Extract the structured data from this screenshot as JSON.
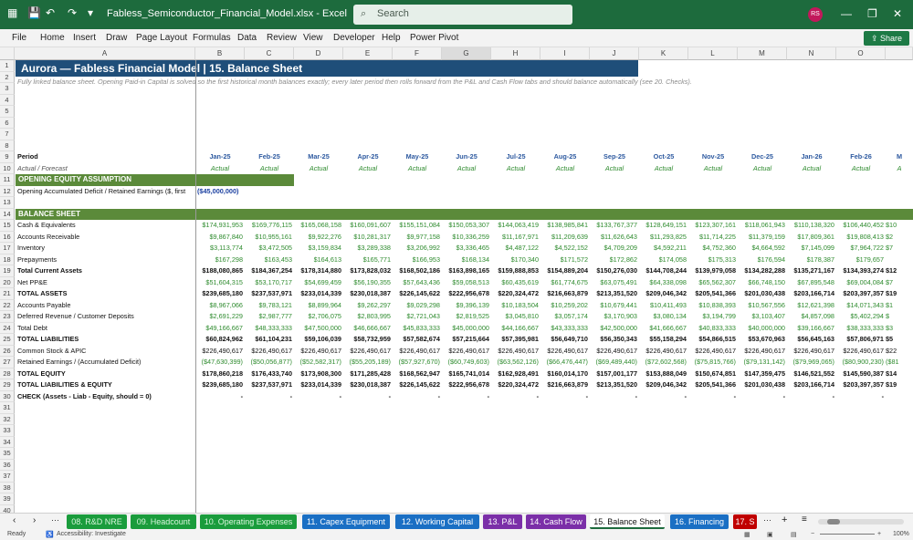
{
  "window": {
    "filename": "Fabless_Semiconductor_Financial_Model.xlsx",
    "app": "Excel",
    "search_placeholder": "Search",
    "avatar_initials": "RS"
  },
  "menu": [
    "File",
    "Home",
    "Insert",
    "Draw",
    "Page Layout",
    "Formulas",
    "Data",
    "Review",
    "View",
    "Developer",
    "Help",
    "Power Pivot"
  ],
  "share_label": "Share",
  "columns": [
    "A",
    "B",
    "C",
    "D",
    "E",
    "F",
    "G",
    "H",
    "I",
    "J",
    "K",
    "L",
    "M",
    "N",
    "O"
  ],
  "row_numbers": [
    "1",
    "2",
    "3",
    "4",
    "5",
    "6",
    "7",
    "8",
    "9",
    "10",
    "11",
    "12",
    "13",
    "14",
    "15",
    "16",
    "17",
    "18",
    "19",
    "20",
    "21",
    "22",
    "23",
    "24",
    "25",
    "26",
    "27",
    "28",
    "29",
    "30",
    "31",
    "32",
    "33",
    "34",
    "35",
    "36",
    "37",
    "38",
    "39",
    "40"
  ],
  "sheet": {
    "title": "Aurora — Fabless Financial Model  |  15. Balance Sheet",
    "note": "Fully linked balance sheet. Opening Paid-in Capital is solved so the first historical month balances exactly; every later period then rolls forward from the P&L and Cash Flow tabs and should balance automatically (see 20. Checks).",
    "period_label": "Period",
    "subtype_label": "Actual / Forecast",
    "periods": [
      "Jan-25",
      "Feb-25",
      "Mar-25",
      "Apr-25",
      "May-25",
      "Jun-25",
      "Jul-25",
      "Aug-25",
      "Sep-25",
      "Oct-25",
      "Nov-25",
      "Dec-25",
      "Jan-26",
      "Feb-26",
      "M"
    ],
    "subtypes": [
      "Actual",
      "Actual",
      "Actual",
      "Actual",
      "Actual",
      "Actual",
      "Actual",
      "Actual",
      "Actual",
      "Actual",
      "Actual",
      "Actual",
      "Actual",
      "Actual",
      "A"
    ],
    "opening_section": "OPENING EQUITY ASSUMPTION",
    "opening_label": "Opening Accumulated Deficit / Retained Earnings ($, first",
    "opening_value": "($45,000,000)",
    "balance_section": "BALANCE SHEET",
    "rows": [
      {
        "label": "Cash & Equivalents",
        "style": "n",
        "vals": [
          "$174,931,953",
          "$169,776,115",
          "$165,068,158",
          "$160,091,607",
          "$155,151,084",
          "$150,053,307",
          "$144,063,419",
          "$138,985,841",
          "$133,767,377",
          "$128,649,151",
          "$123,307,161",
          "$118,061,943",
          "$110,138,320",
          "$106,440,452",
          "$10"
        ]
      },
      {
        "label": "Accounts Receivable",
        "style": "n",
        "vals": [
          "$9,867,840",
          "$10,955,161",
          "$9,922,276",
          "$10,281,317",
          "$9,977,158",
          "$10,336,259",
          "$11,167,971",
          "$11,209,639",
          "$11,626,643",
          "$11,293,825",
          "$11,714,225",
          "$11,379,159",
          "$17,809,361",
          "$19,808,413",
          "$2"
        ]
      },
      {
        "label": "Inventory",
        "style": "n",
        "vals": [
          "$3,113,774",
          "$3,472,505",
          "$3,159,834",
          "$3,289,338",
          "$3,206,992",
          "$3,336,465",
          "$4,487,122",
          "$4,522,152",
          "$4,709,209",
          "$4,592,211",
          "$4,752,360",
          "$4,664,592",
          "$7,145,099",
          "$7,964,722",
          "$7"
        ]
      },
      {
        "label": "Prepayments",
        "style": "n",
        "vals": [
          "$167,298",
          "$163,453",
          "$164,613",
          "$165,771",
          "$166,953",
          "$168,134",
          "$170,340",
          "$171,572",
          "$172,862",
          "$174,058",
          "$175,313",
          "$176,594",
          "$178,387",
          "$179,657",
          ""
        ]
      },
      {
        "label": "Total Current Assets",
        "style": "b",
        "vals": [
          "$188,080,865",
          "$184,367,254",
          "$178,314,880",
          "$173,828,032",
          "$168,502,186",
          "$163,898,165",
          "$159,888,853",
          "$154,889,204",
          "$150,276,030",
          "$144,708,244",
          "$139,979,058",
          "$134,282,288",
          "$135,271,167",
          "$134,393,274",
          "$12"
        ]
      },
      {
        "label": "Net PP&E",
        "style": "n",
        "vals": [
          "$51,604,315",
          "$53,170,717",
          "$54,699,459",
          "$56,190,355",
          "$57,643,436",
          "$59,058,513",
          "$60,435,619",
          "$61,774,675",
          "$63,075,491",
          "$64,338,098",
          "$65,562,307",
          "$66,748,150",
          "$67,895,548",
          "$69,004,084",
          "$7"
        ]
      },
      {
        "label": "TOTAL ASSETS",
        "style": "b",
        "vals": [
          "$239,685,180",
          "$237,537,971",
          "$233,014,339",
          "$230,018,387",
          "$226,145,622",
          "$222,956,678",
          "$220,324,472",
          "$216,663,879",
          "$213,351,520",
          "$209,046,342",
          "$205,541,366",
          "$201,030,438",
          "$203,166,714",
          "$203,397,357",
          "$19"
        ]
      },
      {
        "label": "Accounts Payable",
        "style": "n",
        "vals": [
          "$8,967,066",
          "$9,783,121",
          "$8,899,964",
          "$9,262,297",
          "$9,029,298",
          "$9,396,139",
          "$10,183,504",
          "$10,259,202",
          "$10,679,441",
          "$10,411,493",
          "$10,838,393",
          "$10,567,556",
          "$12,621,398",
          "$14,071,343",
          "$1"
        ]
      },
      {
        "label": "Deferred Revenue / Customer Deposits",
        "style": "n",
        "vals": [
          "$2,691,229",
          "$2,987,777",
          "$2,706,075",
          "$2,803,995",
          "$2,721,043",
          "$2,819,525",
          "$3,045,810",
          "$3,057,174",
          "$3,170,903",
          "$3,080,134",
          "$3,194,799",
          "$3,103,407",
          "$4,857,098",
          "$5,402,294",
          "$"
        ]
      },
      {
        "label": "Total Debt",
        "style": "n",
        "vals": [
          "$49,166,667",
          "$48,333,333",
          "$47,500,000",
          "$46,666,667",
          "$45,833,333",
          "$45,000,000",
          "$44,166,667",
          "$43,333,333",
          "$42,500,000",
          "$41,666,667",
          "$40,833,333",
          "$40,000,000",
          "$39,166,667",
          "$38,333,333",
          "$3"
        ]
      },
      {
        "label": "TOTAL LIABILITIES",
        "style": "b",
        "vals": [
          "$60,824,962",
          "$61,104,231",
          "$59,106,039",
          "$58,732,959",
          "$57,582,674",
          "$57,215,664",
          "$57,395,981",
          "$56,649,710",
          "$56,350,343",
          "$55,158,294",
          "$54,866,515",
          "$53,670,963",
          "$56,645,163",
          "$57,806,971",
          "$5"
        ]
      },
      {
        "label": "Common Stock & APIC",
        "style": "k",
        "vals": [
          "$226,490,617",
          "$226,490,617",
          "$226,490,617",
          "$226,490,617",
          "$226,490,617",
          "$226,490,617",
          "$226,490,617",
          "$226,490,617",
          "$226,490,617",
          "$226,490,617",
          "$226,490,617",
          "$226,490,617",
          "$226,490,617",
          "$226,490,617",
          "$22"
        ]
      },
      {
        "label": "Retained Earnings / (Accumulated Deficit)",
        "style": "n",
        "vals": [
          "($47,630,399)",
          "($50,056,877)",
          "($52,582,317)",
          "($55,205,189)",
          "($57,927,670)",
          "($60,749,603)",
          "($63,562,126)",
          "($66,476,447)",
          "($69,489,440)",
          "($72,602,568)",
          "($75,815,766)",
          "($79,131,142)",
          "($79,969,065)",
          "($80,900,230)",
          "($81"
        ]
      },
      {
        "label": "TOTAL EQUITY",
        "style": "b",
        "vals": [
          "$178,860,218",
          "$176,433,740",
          "$173,908,300",
          "$171,285,428",
          "$168,562,947",
          "$165,741,014",
          "$162,928,491",
          "$160,014,170",
          "$157,001,177",
          "$153,888,049",
          "$150,674,851",
          "$147,359,475",
          "$146,521,552",
          "$145,590,387",
          "$14"
        ]
      },
      {
        "label": "TOTAL LIABILITIES & EQUITY",
        "style": "b",
        "vals": [
          "$239,685,180",
          "$237,537,971",
          "$233,014,339",
          "$230,018,387",
          "$226,145,622",
          "$222,956,678",
          "$220,324,472",
          "$216,663,879",
          "$213,351,520",
          "$209,046,342",
          "$205,541,366",
          "$201,030,438",
          "$203,166,714",
          "$203,397,357",
          "$19"
        ]
      },
      {
        "label": "CHECK  (Assets - Liab - Equity, should = 0)",
        "style": "b",
        "vals": [
          "-",
          "-",
          "-",
          "-",
          "-",
          "-",
          "-",
          "-",
          "-",
          "-",
          "-",
          "-",
          "-",
          "-",
          ""
        ]
      }
    ]
  },
  "tabs": [
    {
      "label": "08. R&D NRE",
      "color": "g"
    },
    {
      "label": "09. Headcount",
      "color": "g"
    },
    {
      "label": "10. Operating Expenses",
      "color": "g"
    },
    {
      "label": "11. Capex Equipment",
      "color": "bl"
    },
    {
      "label": "12. Working Capital",
      "color": "bl"
    },
    {
      "label": "13. P&L",
      "color": "pu"
    },
    {
      "label": "14. Cash Flow",
      "color": "pu"
    },
    {
      "label": "15. Balance Sheet",
      "color": "act"
    },
    {
      "label": "16. Financing",
      "color": "bl"
    },
    {
      "label": "17. S",
      "color": "rd"
    }
  ],
  "status": {
    "ready": "Ready",
    "accessibility": "Accessibility: Investigate",
    "zoom": "100%"
  }
}
